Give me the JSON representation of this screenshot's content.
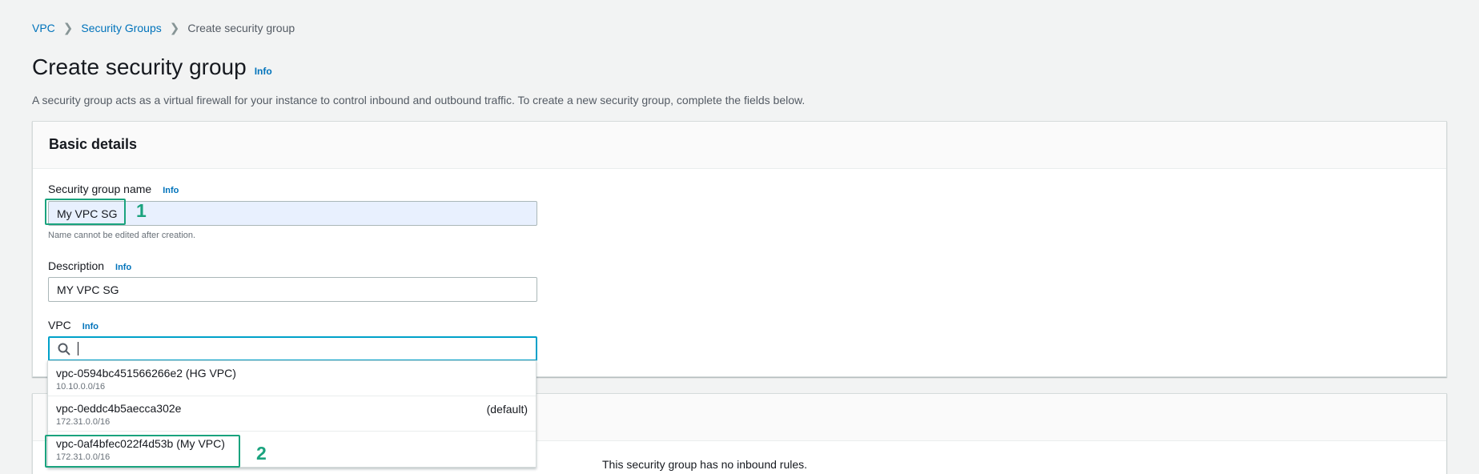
{
  "breadcrumb": {
    "items": [
      "VPC",
      "Security Groups"
    ],
    "current": "Create security group"
  },
  "page": {
    "title": "Create security group",
    "info": "Info",
    "description": "A security group acts as a virtual firewall for your instance to control inbound and outbound traffic. To create a new security group, complete the fields below."
  },
  "basic_details": {
    "title": "Basic details",
    "name_label": "Security group name",
    "name_info": "Info",
    "name_value": "My VPC SG",
    "name_hint": "Name cannot be edited after creation.",
    "desc_label": "Description",
    "desc_info": "Info",
    "desc_value": "MY VPC SG",
    "vpc_label": "VPC",
    "vpc_info": "Info",
    "vpc_search_value": ""
  },
  "vpc_options": [
    {
      "label": "vpc-0594bc451566266e2 (HG VPC)",
      "cidr": "10.10.0.0/16",
      "tag": ""
    },
    {
      "label": "vpc-0eddc4b5aecca302e",
      "cidr": "172.31.0.0/16",
      "tag": "(default)"
    },
    {
      "label": "vpc-0af4bfec022f4d53b (My VPC)",
      "cidr": "172.31.0.0/16",
      "tag": ""
    }
  ],
  "inbound": {
    "empty_message": "This security group has no inbound rules."
  },
  "annotations": [
    "1",
    "2"
  ],
  "colors": {
    "accent": "#0073bb",
    "annotation": "#1aa37e",
    "focus": "#00a1c9"
  }
}
